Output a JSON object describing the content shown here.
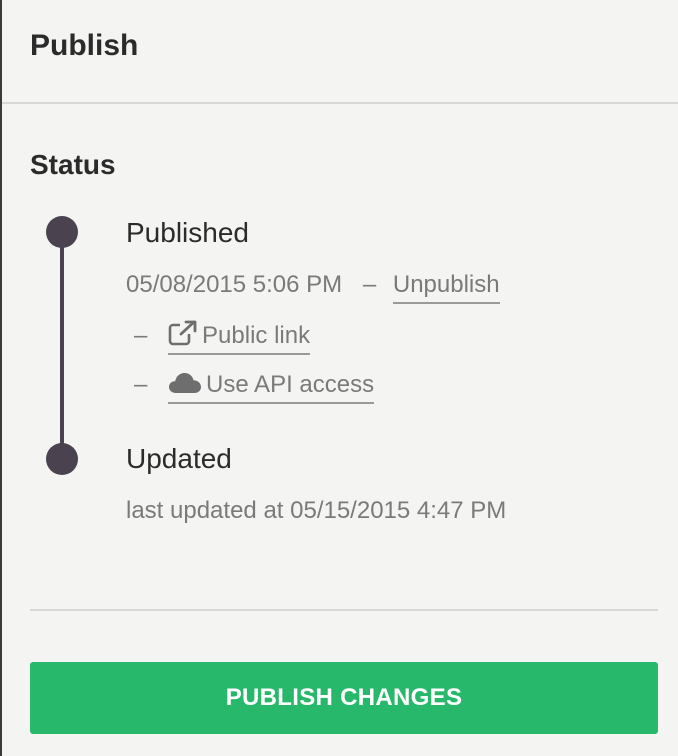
{
  "panel": {
    "title": "Publish"
  },
  "status": {
    "heading": "Status",
    "published": {
      "label": "Published",
      "timestamp": "05/08/2015 5:06 PM",
      "separator": "–",
      "unpublish_label": "Unpublish",
      "public_link_label": "Public link",
      "api_access_label": "Use API access",
      "dash": "–"
    },
    "updated": {
      "label": "Updated",
      "text": "last updated at 05/15/2015 4:47 PM"
    }
  },
  "actions": {
    "publish_label": "PUBLISH CHANGES"
  },
  "colors": {
    "accent": "#28b86b",
    "timeline": "#4a434f",
    "muted_text": "#7a7a7a"
  },
  "icons": {
    "public_link": "external-link-icon",
    "api_access": "cloud-icon"
  }
}
